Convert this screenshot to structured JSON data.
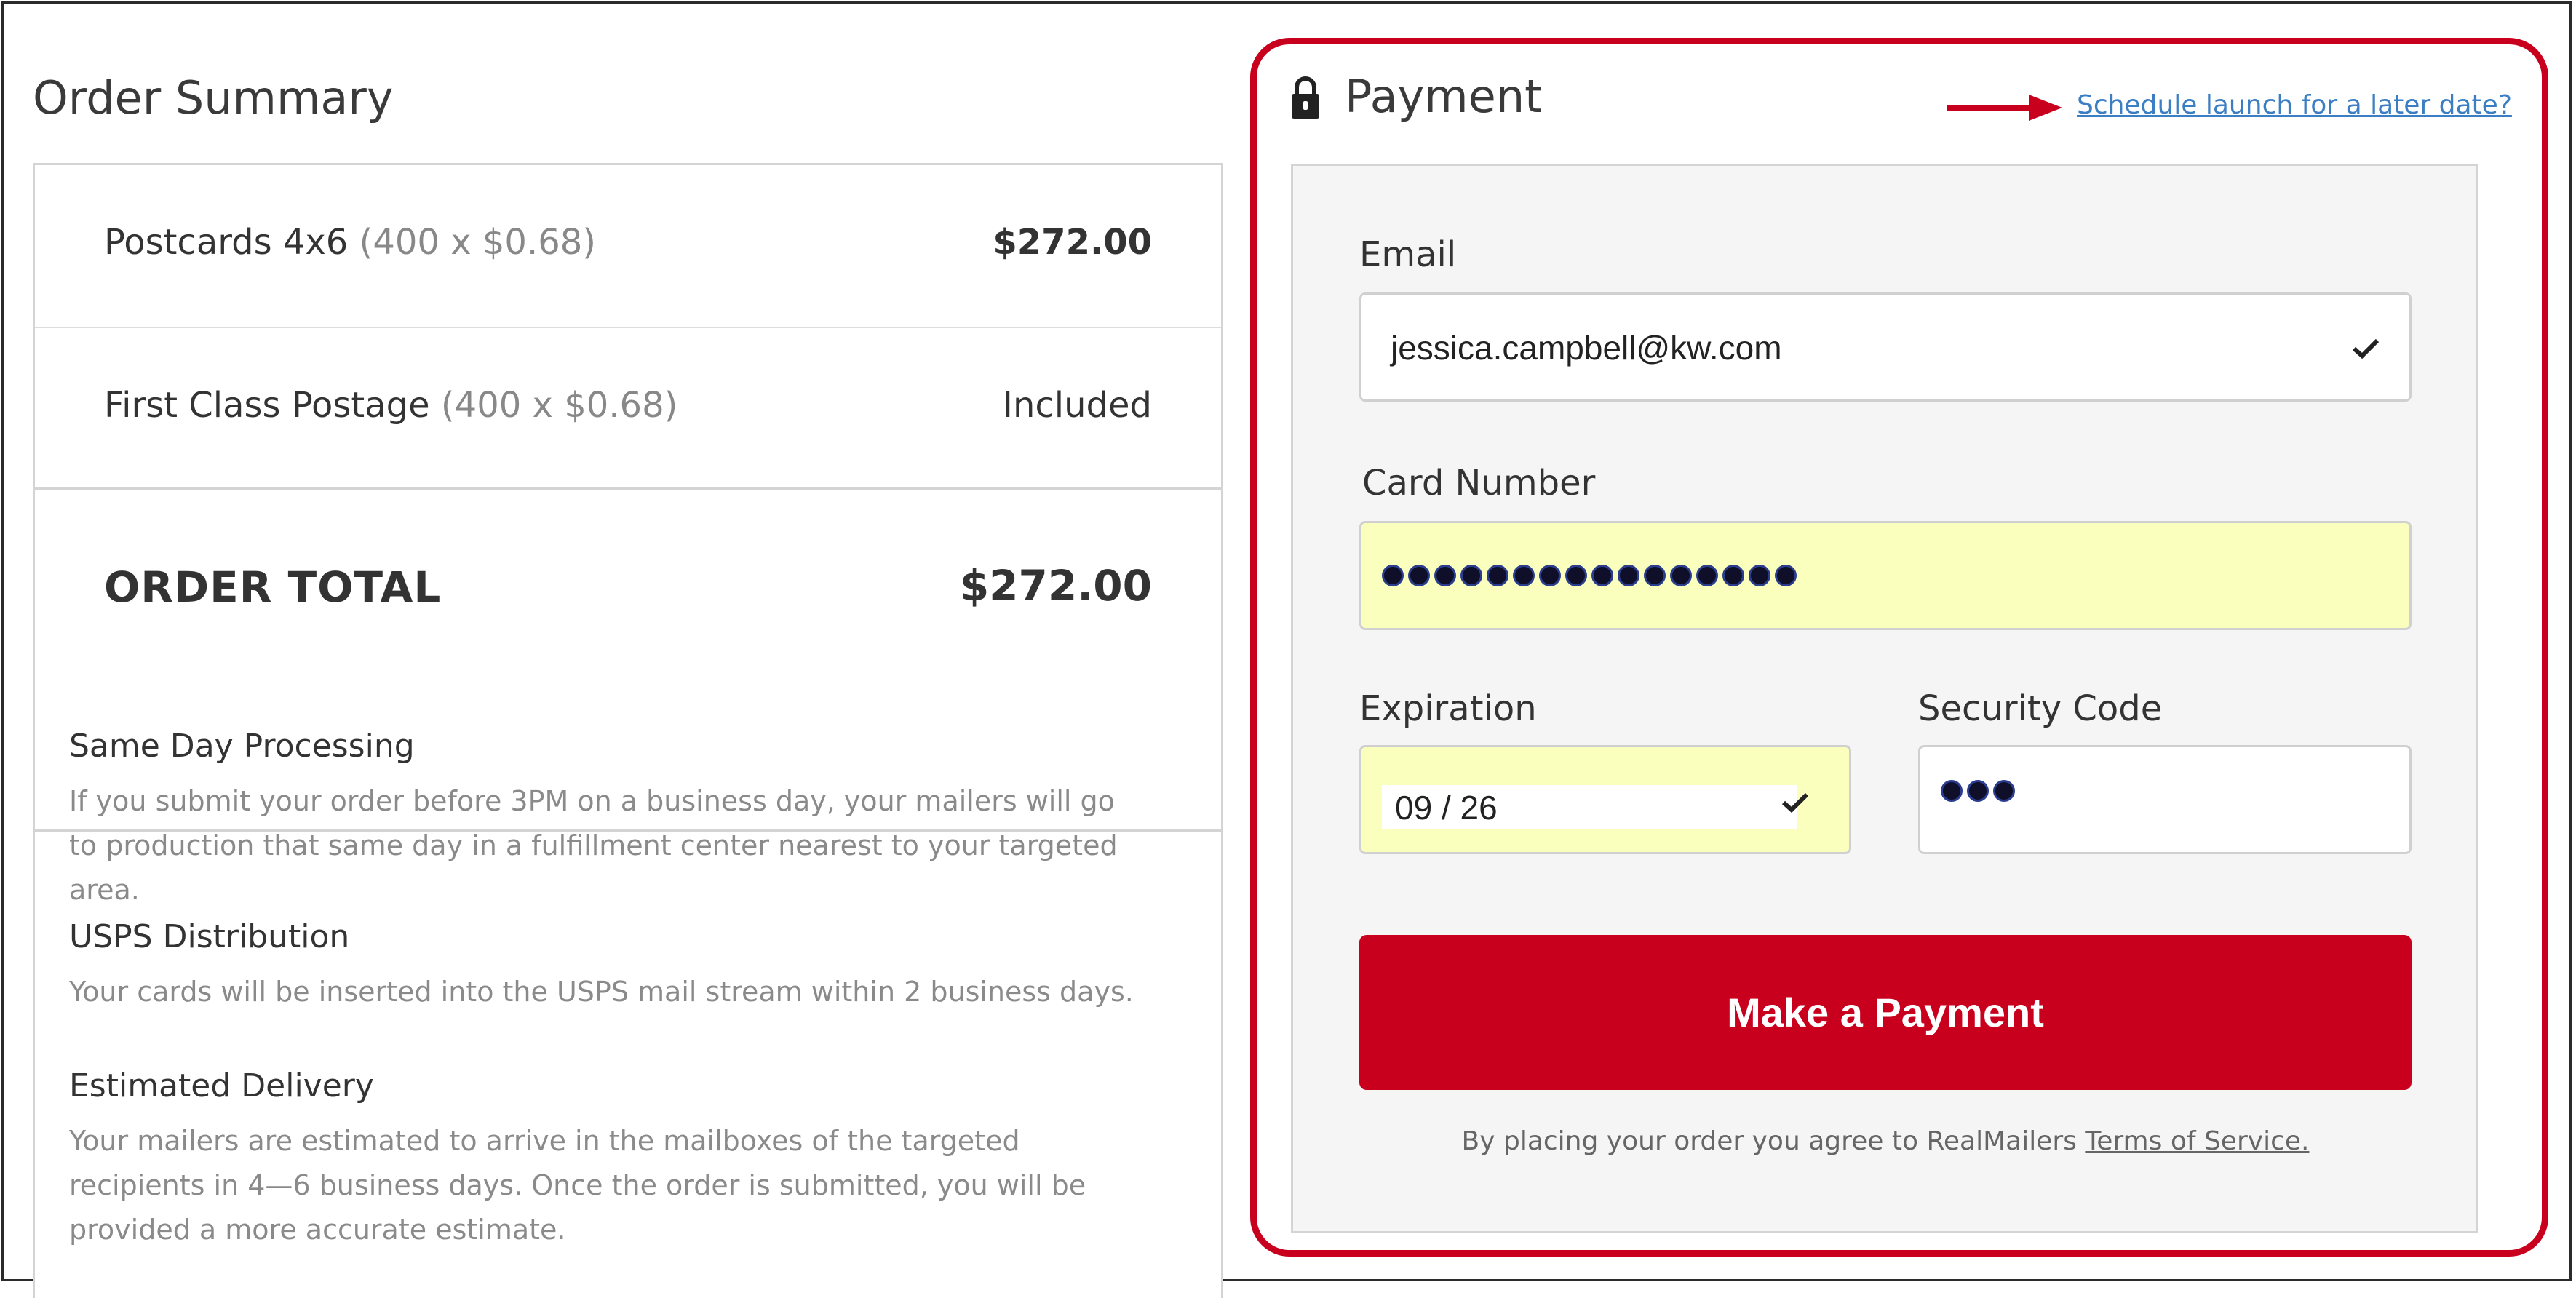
{
  "order_summary": {
    "title": "Order Summary",
    "items": [
      {
        "name": "Postcards 4x6",
        "qty": "(400 x $0.68)",
        "value": "$272.00"
      },
      {
        "name": "First Class Postage",
        "qty": "(400 x $0.68)",
        "value": "Included"
      }
    ],
    "total_label": "ORDER TOTAL",
    "total_value": "$272.00",
    "info": [
      {
        "title": "Same Day Processing",
        "text": "If you submit your order before 3PM on a business day, your mailers will go to production that same day in a fulfillment center nearest to your targeted area."
      },
      {
        "title": "USPS Distribution",
        "text": "Your cards will be inserted into the USPS mail stream within 2 business days."
      },
      {
        "title": "Estimated Delivery",
        "text": "Your mailers are estimated to arrive in the mailboxes of the targeted recipients in 4—6 business days. Once the order is submitted, you will be provided a more accurate estimate."
      }
    ]
  },
  "payment": {
    "title": "Payment",
    "schedule_link": "Schedule launch for a later date?",
    "email_label": "Email",
    "email_value": "jessica.campbell@kw.com",
    "card_label": "Card Number",
    "card_masked_count": 16,
    "expiration_label": "Expiration",
    "expiration_value": "09 / 26",
    "security_label": "Security Code",
    "security_masked_count": 3,
    "button_label": "Make a Payment",
    "terms_text": "By placing your order you agree to RealMailers",
    "terms_link": "Terms of Service."
  },
  "icons": {
    "lock": "lock-icon",
    "arrow": "arrow-right-icon",
    "check": "check-icon"
  },
  "colors": {
    "brand_red": "#c8001e",
    "link_blue": "#3b7ec4",
    "autofill_yellow": "#faffbd"
  }
}
